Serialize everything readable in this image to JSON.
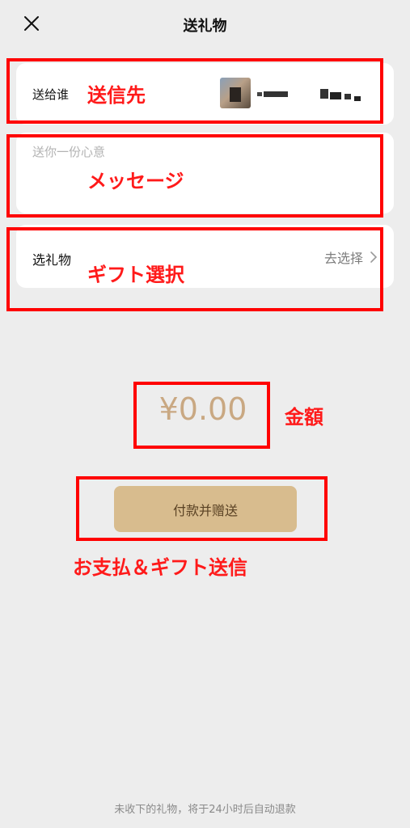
{
  "header": {
    "title": "送礼物",
    "close_icon": "close-icon"
  },
  "recipient": {
    "label": "送给谁"
  },
  "message": {
    "placeholder": "送你一份心意",
    "value": ""
  },
  "gift": {
    "label": "选礼物",
    "select_text": "去选择",
    "chevron_icon": "chevron-right-icon"
  },
  "amount": {
    "value": "¥0.00"
  },
  "pay_button": {
    "label": "付款并赠送"
  },
  "footer": {
    "note": "未收下的礼物，将于24小时后自动退款"
  },
  "annotations": {
    "recipient": "送信先",
    "message": "メッセージ",
    "gift": "ギフト選択",
    "amount": "金額",
    "pay": "お支払＆ギフト送信"
  },
  "colors": {
    "annotation_red": "#ff0000",
    "button_gold": "#d8bc8e",
    "amount_gold": "#c9a882",
    "background": "#ededed"
  }
}
